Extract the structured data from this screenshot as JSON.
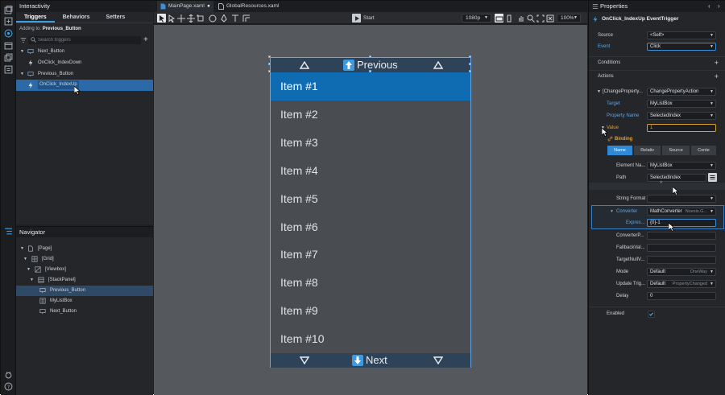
{
  "interactivity": {
    "title": "Interactivity",
    "tabs": [
      "Triggers",
      "Behaviors",
      "Setters"
    ],
    "adding_prefix": "Adding to:",
    "adding_target": "Previous_Button",
    "search_placeholder": "Search triggers",
    "tree": [
      {
        "label": "Next_Button",
        "type": "element"
      },
      {
        "label": "OnClick_IndexDown",
        "type": "trigger"
      },
      {
        "label": "Previous_Button",
        "type": "element"
      },
      {
        "label": "OnClick_IndexUp",
        "type": "trigger",
        "selected": true
      }
    ]
  },
  "navigator": {
    "title": "Navigator",
    "tree": [
      {
        "label": "[Page]"
      },
      {
        "label": "[Grid]"
      },
      {
        "label": "[Viewbox]"
      },
      {
        "label": "[StackPanel]"
      },
      {
        "label": "Previous_Button",
        "selected": true
      },
      {
        "label": "MyListBox"
      },
      {
        "label": "Next_Button"
      }
    ]
  },
  "documents": {
    "tabs": [
      {
        "label": "MainPage.xaml",
        "modified": true,
        "active": true
      },
      {
        "label": "GlobalResources.xaml",
        "active": false
      }
    ]
  },
  "toolbar": {
    "start_label": "Start",
    "resolution": "1080p",
    "zoom": "100%"
  },
  "artboard": {
    "previous_label": "Previous",
    "next_label": "Next",
    "items": [
      "Item #1",
      "Item #2",
      "Item #3",
      "Item #4",
      "Item #5",
      "Item #6",
      "Item #7",
      "Item #8",
      "Item #9",
      "Item #10"
    ],
    "selected_index": 0
  },
  "properties": {
    "title": "Properties",
    "header": "OnClick_IndexUp  EventTrigger",
    "source_label": "Source",
    "source_value": "<Self>",
    "event_label": "Event",
    "event_value": "Click",
    "conditions_label": "Conditions",
    "actions_label": "Actions",
    "action_name": "[ChangeProperty...",
    "action_type": "ChangePropertyAction",
    "target_label": "Target",
    "target_value": "MyListBox",
    "propname_label": "Property Name",
    "propname_value": "SelectedIndex",
    "value_label": "Value",
    "value_value": "1",
    "binding_label": "Binding",
    "binding_tabs": [
      "Name",
      "Relativ",
      "Source",
      "Conte"
    ],
    "element_name_label": "Element Na...",
    "element_name_value": "MyListBox",
    "path_label": "Path",
    "path_value": "SelectedIndex",
    "string_format_label": "String Format",
    "converter_label": "Converter",
    "converter_value": "MathConverter",
    "converter_hint": "Noesis.G...",
    "expression_label": "Expres...",
    "expression_value": "{0}-1",
    "converter_param_label": "ConverterP...",
    "fallback_label": "FallbackVal...",
    "target_null_label": "TargetNullV...",
    "mode_label": "Mode",
    "mode_value": "Default",
    "mode_hint": "OneWay",
    "update_label": "Update Trig...",
    "update_value": "Default",
    "update_hint": "PropertyChanged",
    "delay_label": "Delay",
    "delay_value": "0",
    "enabled_label": "Enabled"
  },
  "colors": {
    "accent": "#3aa0e8",
    "selection": "#2b6aa6",
    "list_selected": "#0f6cb3",
    "value_highlight": "#d6a12a"
  }
}
